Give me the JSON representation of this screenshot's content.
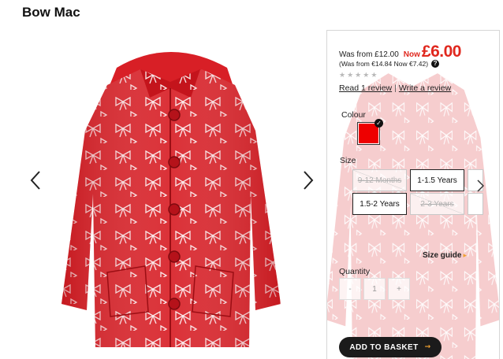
{
  "product": {
    "title": "Bow Mac"
  },
  "gallery": {
    "prev_icon": "chevron-left-icon",
    "next_icon": "chevron-right-icon",
    "image": "red raincoat with white bow print"
  },
  "price": {
    "was_text": "Was from £12.00",
    "now_label": "Now",
    "now_price": "£6.00",
    "euro_text": "(Was from €14.84 Now €7.42)",
    "help_icon": "?",
    "accent_color": "#e0281e"
  },
  "rating": {
    "stars": 0,
    "max": 5,
    "star_glyph": "★"
  },
  "reviews": {
    "read_label": "Read 1 review",
    "separator": "|",
    "write_label": "Write a review"
  },
  "colour": {
    "label": "Colour",
    "selected_color": "#ee0000",
    "check_glyph": "✓"
  },
  "size": {
    "label": "Size",
    "options": [
      {
        "label": "9-12 Months",
        "available": false
      },
      {
        "label": "1-1.5 Years",
        "available": true
      },
      {
        "label": "1.5-2 Years",
        "available": true
      },
      {
        "label": "2-3 Years",
        "available": false
      }
    ]
  },
  "size_guide": {
    "label": "Size guide",
    "icon": "▸"
  },
  "quantity": {
    "label": "Quantity",
    "minus": "-",
    "value": "1",
    "plus": "+"
  },
  "basket": {
    "label": "ADD TO BASKET",
    "icon": "→"
  }
}
